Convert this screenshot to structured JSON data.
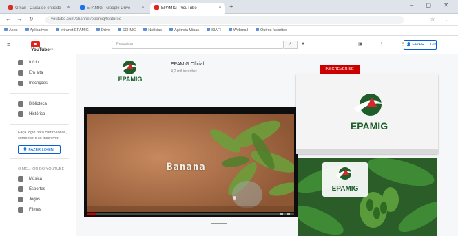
{
  "browser": {
    "tabs": [
      {
        "label": "Gmail - Caixa de entrada",
        "fav_color": "#d93025",
        "active": false
      },
      {
        "label": "EPAMIG - Google Drive",
        "fav_color": "#1a73e8",
        "active": false
      },
      {
        "label": "EPAMIG - YouTube",
        "fav_color": "#e62117",
        "active": true
      }
    ],
    "new_tab": "+",
    "window_buttons": "– ▢ ✕",
    "url": "youtube.com/channel/epamig/featured",
    "nav_back": "←",
    "nav_forward": "→",
    "nav_reload": "↻",
    "nav_right_icons": "☆ ⋮",
    "bookmarks": [
      "Apps",
      "Aplicativos",
      "Intranet EPAMIG",
      "Drive",
      "SEI-MG",
      "Notícias",
      "Agência Minas",
      "SIAFI",
      "Webmail",
      "Outros favoritos"
    ]
  },
  "youtube": {
    "menu_icon": "≡",
    "logo_word": "YouTube",
    "logo_suffix": "BR",
    "search_placeholder": "Pesquisar",
    "search_icon": "⌕",
    "mic_icon": "🎤",
    "header_icons": "▣ ⋮ ⋮",
    "signin_label": "👤 FAZER LOGIN"
  },
  "sidebar": {
    "items_top": [
      {
        "label": "Início"
      },
      {
        "label": "Em alta"
      },
      {
        "label": "Inscrições"
      }
    ],
    "items_mid": [
      {
        "label": "Biblioteca"
      },
      {
        "label": "Histórico"
      }
    ],
    "signin_text": "Faça login para curtir vídeos, comentar e se inscrever.",
    "signin_label": "FAZER LOGIN",
    "section_title": "O MELHOR DO YOUTUBE",
    "items_bottom": [
      {
        "label": "Música"
      },
      {
        "label": "Esportes"
      },
      {
        "label": "Jogos"
      },
      {
        "label": "Filmes"
      }
    ]
  },
  "channel": {
    "name": "EPAMIG Oficial",
    "subscribers": "4,2 mil inscritos",
    "subscribe_label": "INSCREVER-SE",
    "logo_text": "EPAMIG",
    "brand_green": "#1d5e2b",
    "brand_red": "#d6282b"
  },
  "video": {
    "overlay_title": "Banana",
    "progress_fraction": 0.04
  }
}
